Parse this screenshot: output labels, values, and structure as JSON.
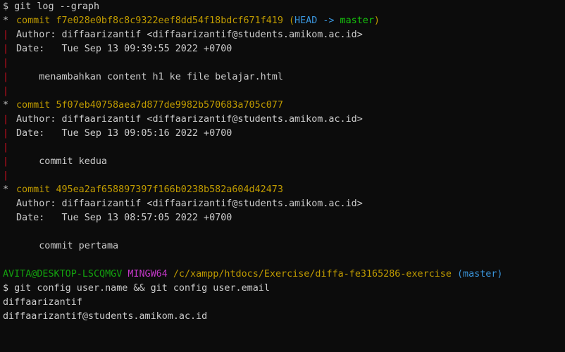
{
  "prompt_symbol": "$",
  "commands": {
    "first": "git log --graph",
    "second": "git config user.name && git config user.email"
  },
  "commits": [
    {
      "label": "commit",
      "hash": "f7e028e0bf8c8c9322eef8dd54f18bdcf671f419",
      "refs": {
        "open": "(",
        "head": "HEAD",
        "arrow": "->",
        "branch": "master",
        "close": ")"
      },
      "author": "Author: diffaarizantif <diffaarizantif@students.amikom.ac.id>",
      "date": "Date:   Tue Sep 13 09:39:55 2022 +0700",
      "message": "    menambahkan content h1 ke file belajar.html"
    },
    {
      "label": "commit",
      "hash": "5f07eb40758aea7d877de9982b570683a705c077",
      "author": "Author: diffaarizantif <diffaarizantif@students.amikom.ac.id>",
      "date": "Date:   Tue Sep 13 09:05:16 2022 +0700",
      "message": "    commit kedua"
    },
    {
      "label": "commit",
      "hash": "495ea2af658897397f166b0238b582a604d42473",
      "author": "Author: diffaarizantif <diffaarizantif@students.amikom.ac.id>",
      "date": "Date:   Tue Sep 13 08:57:05 2022 +0700",
      "message": "    commit pertama"
    }
  ],
  "graph": {
    "star": "*",
    "bar": "|"
  },
  "prompt": {
    "user_host": "AVITA@DESKTOP-LSCQMGV",
    "system": "MINGW64",
    "path": "/c/xampp/htdocs/Exercise/diffa-fe3165286-exercise",
    "branch": "(master)"
  },
  "output": {
    "name": "diffaarizantif",
    "email": "diffaarizantif@students.amikom.ac.id"
  },
  "colors": {
    "background": "#0c0c0c",
    "text": "#cccccc",
    "commit_yellow": "#c19c00",
    "head_cyan": "#3a96dd",
    "branch_green": "#16c60c",
    "graph_red": "#c50f1f",
    "prompt_green": "#13a10e",
    "prompt_magenta": "#c438c8"
  }
}
